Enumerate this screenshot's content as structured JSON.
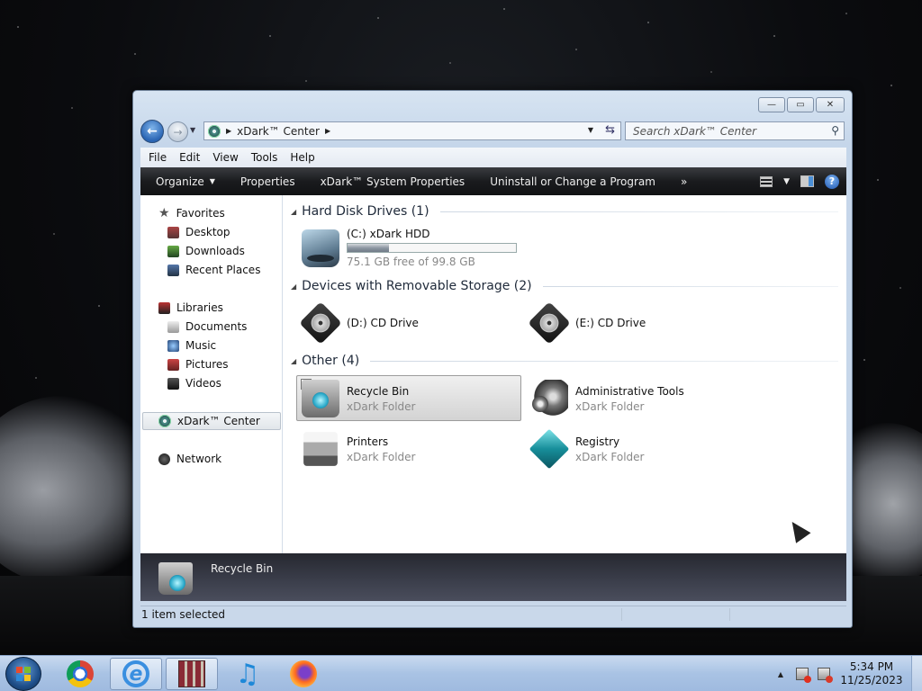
{
  "window": {
    "address": {
      "path": "xDark™ Center"
    },
    "search": {
      "placeholder": "Search xDark™ Center"
    },
    "menu": [
      "File",
      "Edit",
      "View",
      "Tools",
      "Help"
    ],
    "toolbar": {
      "organize": "Organize",
      "properties": "Properties",
      "system_properties": "xDark™ System Properties",
      "uninstall": "Uninstall or Change a Program",
      "more": "»"
    },
    "nav": {
      "favorites": "Favorites",
      "desktop": "Desktop",
      "downloads": "Downloads",
      "recent": "Recent Places",
      "libraries": "Libraries",
      "documents": "Documents",
      "music": "Music",
      "pictures": "Pictures",
      "videos": "Videos",
      "computer": "xDark™ Center",
      "network": "Network"
    },
    "groups": {
      "hdd": {
        "title": "Hard Disk Drives (1)",
        "drive_name": "(C:) xDark HDD",
        "drive_space": "75.1 GB free of 99.8 GB",
        "used_fraction": 0.247
      },
      "removable": {
        "title": "Devices with Removable Storage (2)",
        "d_drive": "(D:) CD Drive",
        "e_drive": "(E:) CD Drive"
      },
      "other": {
        "title": "Other (4)",
        "recycle_name": "Recycle Bin",
        "recycle_type": "xDark Folder",
        "admin_name": "Administrative Tools",
        "admin_type": "xDark Folder",
        "printers_name": "Printers",
        "printers_type": "xDark Folder",
        "registry_name": "Registry",
        "registry_type": "xDark Folder"
      }
    },
    "details": {
      "selected_name": "Recycle Bin"
    },
    "status": {
      "text": "1 item selected"
    }
  },
  "taskbar": {
    "clock_time": "5:34 PM",
    "clock_date": "11/25/2023"
  }
}
